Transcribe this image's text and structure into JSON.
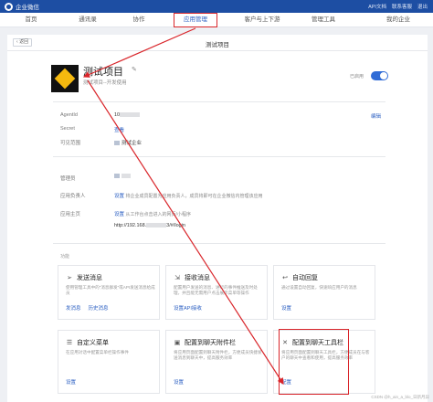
{
  "topbar": {
    "brand": "企业微信",
    "links": [
      "API文档",
      "联系客服",
      "退出"
    ]
  },
  "nav": {
    "items": [
      "首页",
      "通讯录",
      "协作",
      "应用管理",
      "客户与上下游",
      "管理工具",
      "我的企业"
    ],
    "active": "应用管理"
  },
  "page": {
    "back_label": "返回",
    "title": "测试项目"
  },
  "app": {
    "name": "测试项目",
    "description": "测试项目--开发使用",
    "enabled_label": "已启用",
    "enabled": true
  },
  "details": {
    "agentid_label": "AgentId",
    "agentid_value": "10",
    "edit_label": "编辑",
    "secret_label": "Secret",
    "secret_value": "查看",
    "visible_label": "可见范围",
    "visible_value": "测试企业",
    "admin_label": "管理员",
    "owner_label": "应用负责人",
    "owner_link": "设置",
    "owner_text": "将企业成员配置为应用负责人，成员将即可在企业微信内管理该应用",
    "homepage_label": "应用主页",
    "homepage_link": "设置",
    "homepage_note": "从工作台点击进入的网页/小程序",
    "homepage_url_prefix": "http://192.168.",
    "homepage_url_suffix": "3/#/login"
  },
  "features": {
    "section_label": "功能",
    "cards": [
      {
        "title": "发送消息",
        "icon": "send-icon",
        "desc": "使用管理工具中的“消息群发”或API发送消息给成员",
        "links": [
          "发消息",
          "历史消息"
        ]
      },
      {
        "title": "接收消息",
        "icon": "receive-icon",
        "desc": "配置用户发送的消息、进行的事件推送及时处理，并且能无需用户点击展示菜单等操作",
        "links": [
          "设置API接收"
        ]
      },
      {
        "title": "自动回复",
        "icon": "reply-icon",
        "desc": "通过设置自动回复，快速响应用户的消息",
        "links": [
          "设置"
        ]
      },
      {
        "title": "自定义菜单",
        "icon": "menu-icon",
        "desc": "在应用对话中配置菜单栏操作事件",
        "links": [
          "设置"
        ]
      },
      {
        "title": "配置到聊天附件栏",
        "icon": "attach-icon",
        "desc": "将应用页面配置到聊天附件栏，方便成员快捷发送消息到聊天中，提高服务效率",
        "links": [
          "设置"
        ]
      },
      {
        "title": "配置到聊天工具栏",
        "icon": "toolbar-icon",
        "desc": "将应用页面配置到聊天工具栏，方便成员在与客户的聊天中查看和使用，提高服务效率",
        "links": [
          "配置"
        ]
      }
    ]
  },
  "watermark": "CSDN @h_ain_a_blo_日新月异",
  "colors": {
    "topbar": "#1d4ea3",
    "accent": "#2b5fc2",
    "annotation": "#d9252a"
  }
}
